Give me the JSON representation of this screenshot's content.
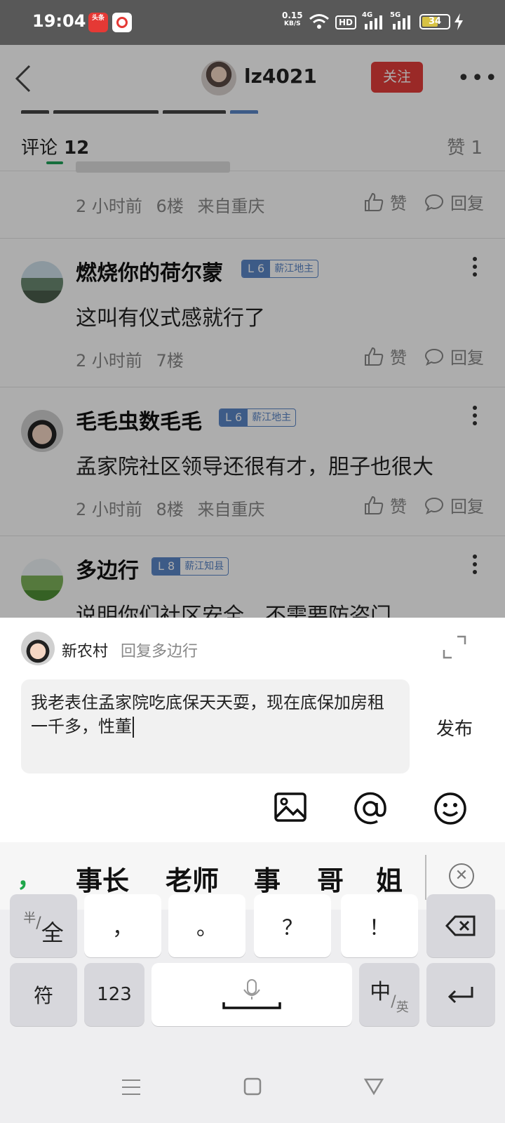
{
  "status_bar": {
    "time": "19:04",
    "toutiao_badge": "头条",
    "net_speed_value": "0.15",
    "net_speed_unit": "KB/S",
    "hd_label": "HD",
    "signal_1": "4G",
    "signal_2": "5G",
    "battery": "34"
  },
  "header": {
    "username": "lz4021",
    "follow_label": "关注"
  },
  "tabs": {
    "comments_label": "评论",
    "comments_count": "12",
    "likes_label": "赞 1"
  },
  "comments": {
    "partial": {
      "time": "2 小时前",
      "floor": "6楼",
      "location": "来自重庆",
      "like_label": "赞",
      "reply_label": "回复"
    },
    "items": [
      {
        "name": "燃烧你的荷尔蒙",
        "level": "L 6",
        "title": "薪江地主",
        "text": "这叫有仪式感就行了",
        "time": "2 小时前",
        "floor": "7楼",
        "location": "",
        "like_label": "赞",
        "reply_label": "回复"
      },
      {
        "name": "毛毛虫数毛毛",
        "level": "L 6",
        "title": "薪江地主",
        "text": "孟家院社区领导还很有才，胆子也很大",
        "time": "2 小时前",
        "floor": "8楼",
        "location": "来自重庆",
        "like_label": "赞",
        "reply_label": "回复"
      },
      {
        "name": "多边行",
        "level": "L 8",
        "title": "薪江知县",
        "text": "说明你们社区安全，不需要防盗门"
      }
    ]
  },
  "reply_sheet": {
    "user": "新农村",
    "reply_to": "回复多边行",
    "input_text": "我老表住孟家院吃底保天天耍，现在底保加房租一千多，性董",
    "publish_label": "发布"
  },
  "keyboard": {
    "candidate_comma": "，",
    "candidates": [
      "事长",
      "老师",
      "事",
      "哥",
      "姐"
    ],
    "keys": {
      "half_full_small": "半",
      "half_full_big": "全",
      "comma": "，",
      "period": "。",
      "question": "？",
      "exclaim": "！",
      "symbols": "符",
      "numbers": "123",
      "lang_big": "中",
      "lang_small": "英"
    }
  },
  "colors": {
    "accent_red": "#e43d3a",
    "tab_green": "#21a35a",
    "level_blue": "#5b86c8"
  }
}
